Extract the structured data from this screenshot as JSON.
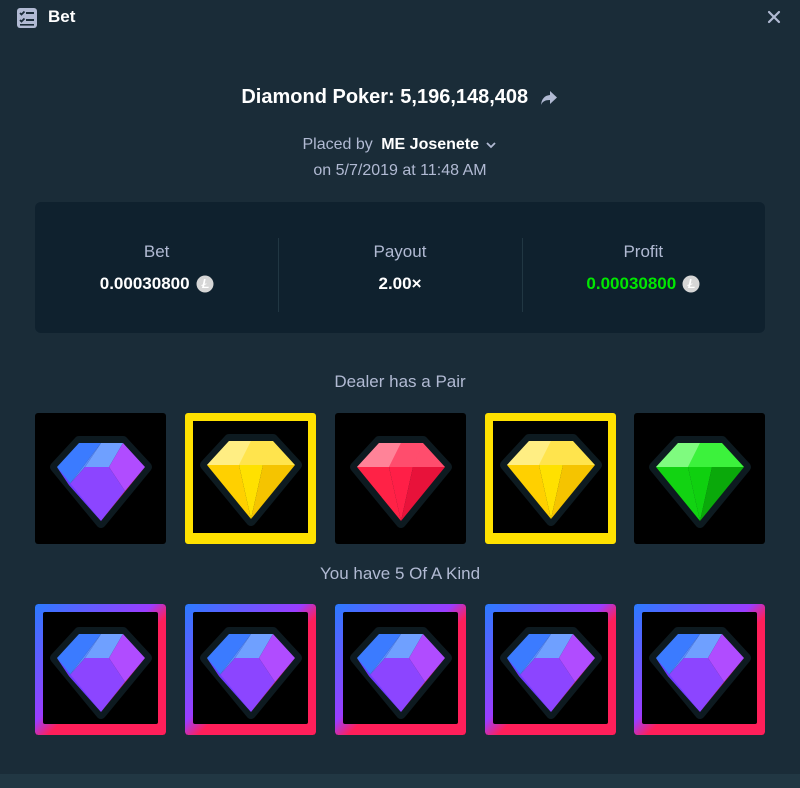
{
  "header": {
    "title": "Bet",
    "icon": "bet-slip-icon",
    "close_icon": "close-icon"
  },
  "game": {
    "title": "Diamond Poker: 5,196,148,408",
    "share_icon": "share-arrow-icon"
  },
  "placed": {
    "prefix": "Placed by",
    "user": "ME Josenete",
    "date": "on 5/7/2019 at 11:48 AM"
  },
  "stats": {
    "bet": {
      "label": "Bet",
      "value": "0.00030800",
      "currency_icon": "litecoin-icon"
    },
    "payout": {
      "label": "Payout",
      "value": "2.00×"
    },
    "profit": {
      "label": "Profit",
      "value": "0.00030800",
      "currency_icon": "litecoin-icon",
      "color": "#00e701"
    }
  },
  "dealer": {
    "label": "Dealer has a Pair",
    "gems": [
      "purple",
      "yellow",
      "red",
      "yellow",
      "green"
    ],
    "highlighted": [
      false,
      true,
      false,
      true,
      false
    ]
  },
  "player": {
    "label": "You have 5 Of A Kind",
    "gems": [
      "purple",
      "purple",
      "purple",
      "purple",
      "purple"
    ],
    "highlighted": [
      true,
      true,
      true,
      true,
      true
    ]
  },
  "colors": {
    "background": "#1a2c38",
    "panel": "#0f212e",
    "text_muted": "#b1bad3",
    "win_green": "#00e701",
    "highlight_yellow": "#ffe100"
  }
}
